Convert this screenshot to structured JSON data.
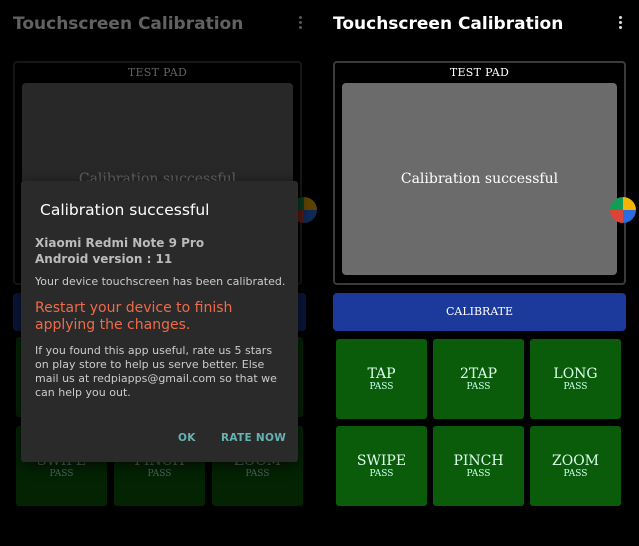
{
  "app": {
    "title": "Touchscreen Calibration"
  },
  "test_pad": {
    "label": "TEST PAD",
    "message": "Calibration successful"
  },
  "calibrate_button": {
    "label": "CALIBRATE"
  },
  "tests": [
    {
      "name": "TAP",
      "status": "PASS"
    },
    {
      "name": "2TAP",
      "status": "PASS"
    },
    {
      "name": "LONG",
      "status": "PASS"
    },
    {
      "name": "SWIPE",
      "status": "PASS"
    },
    {
      "name": "PINCH",
      "status": "PASS"
    },
    {
      "name": "ZOOM",
      "status": "PASS"
    }
  ],
  "dialog": {
    "title": "Calibration successful",
    "device_model": "Xiaomi Redmi Note 9 Pro",
    "android_version": "Android version : 11",
    "calibrated_text": "Your device touchscreen has been calibrated.",
    "restart_text": "Restart your device to finish applying the changes.",
    "rate_text": "If you found this app useful, rate us 5 stars on play store to help us serve better. Else mail us at redpiapps@gmail.com so that we can help you out.",
    "ok_label": "OK",
    "rate_label": "RATE NOW"
  },
  "colors": {
    "calibrate_blue": "#1b3a9b",
    "pass_green": "#0a5c0a",
    "warning_red": "#f06a4a",
    "dialog_button_teal": "#66b3b3"
  },
  "icons": {
    "menu": "more-vert-icon",
    "fab": "app-badge-icon"
  }
}
